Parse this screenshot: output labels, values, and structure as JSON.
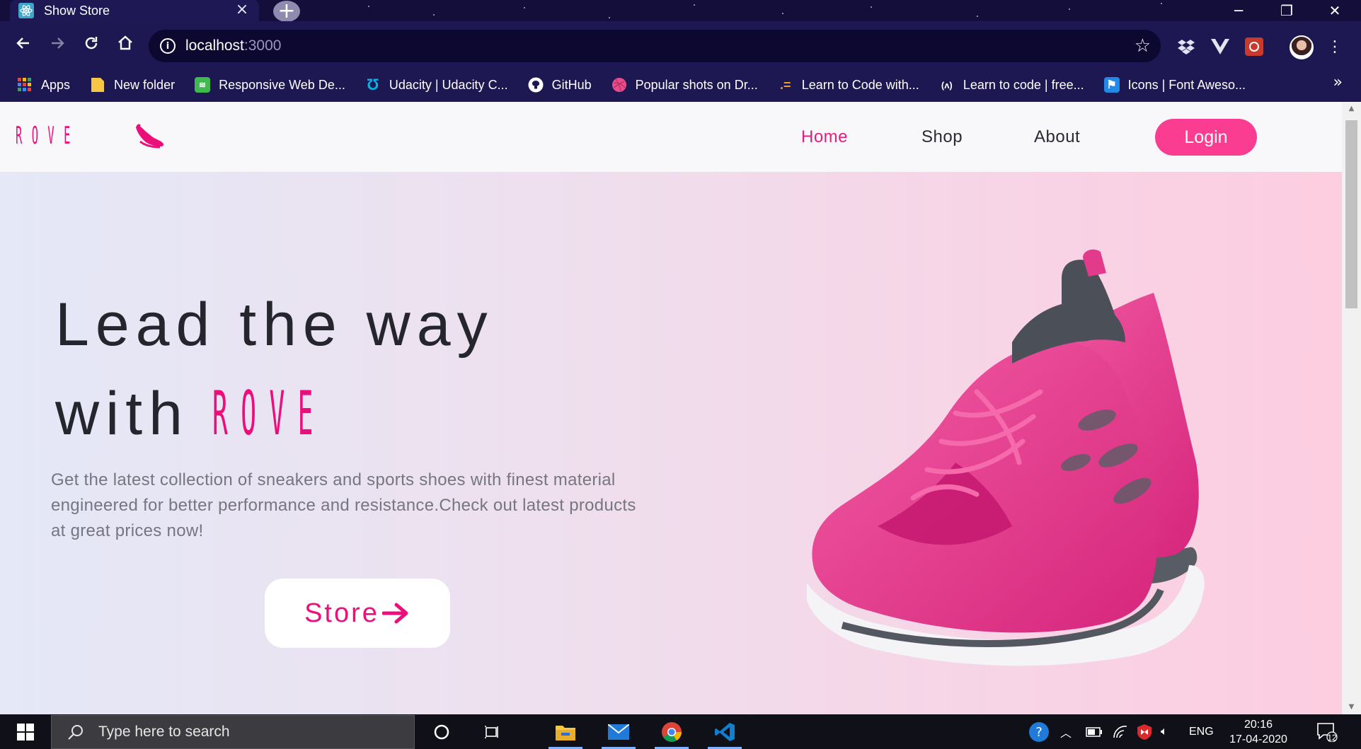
{
  "browser": {
    "tab_title": "Show Store",
    "new_tab_symbol": "+",
    "url_host": "localhost",
    "url_port": ":3000",
    "bookmarks": [
      {
        "label": "Apps",
        "icon": "apps-grid-icon",
        "color": "#ea4335"
      },
      {
        "label": "New folder",
        "icon": "folder-icon",
        "color": "#f6c744"
      },
      {
        "label": "Responsive Web De...",
        "icon": "responsive-web-icon",
        "color": "#3fb950"
      },
      {
        "label": "Udacity | Udacity C...",
        "icon": "udacity-icon",
        "color": "#02b3e4"
      },
      {
        "label": "GitHub",
        "icon": "github-icon",
        "color": "#ffffff"
      },
      {
        "label": "Popular shots on Dr...",
        "icon": "dribbble-icon",
        "color": "#ea4c89"
      },
      {
        "label": "Learn to Code with...",
        "icon": "codecademy-icon",
        "color": "#f0a020"
      },
      {
        "label": "Learn to code | free...",
        "icon": "freecodecamp-icon",
        "color": "#ffffff"
      },
      {
        "label": "Icons | Font Aweso...",
        "icon": "font-awesome-icon",
        "color": "#228ae6"
      }
    ],
    "more_bookmarks": "»"
  },
  "site": {
    "brand": "ROVE",
    "nav": [
      {
        "label": "Home",
        "active": true
      },
      {
        "label": "Shop",
        "active": false
      },
      {
        "label": "About",
        "active": false
      }
    ],
    "login_label": "Login",
    "hero_line1": "Lead the way",
    "hero_line2_prefix": "with",
    "hero_brand": "ROVE",
    "hero_desc": "Get the latest collection of sneakers and sports shoes with finest material engineered for better performance and resistance.Check out latest products at great prices now!",
    "store_label": "Store",
    "accent_color": "#ec0e7a",
    "login_color": "#fb3d91"
  },
  "taskbar": {
    "search_placeholder": "Type here to search",
    "lang": "ENG",
    "time": "20:16",
    "date": "17-04-2020",
    "notification_count": "12"
  }
}
